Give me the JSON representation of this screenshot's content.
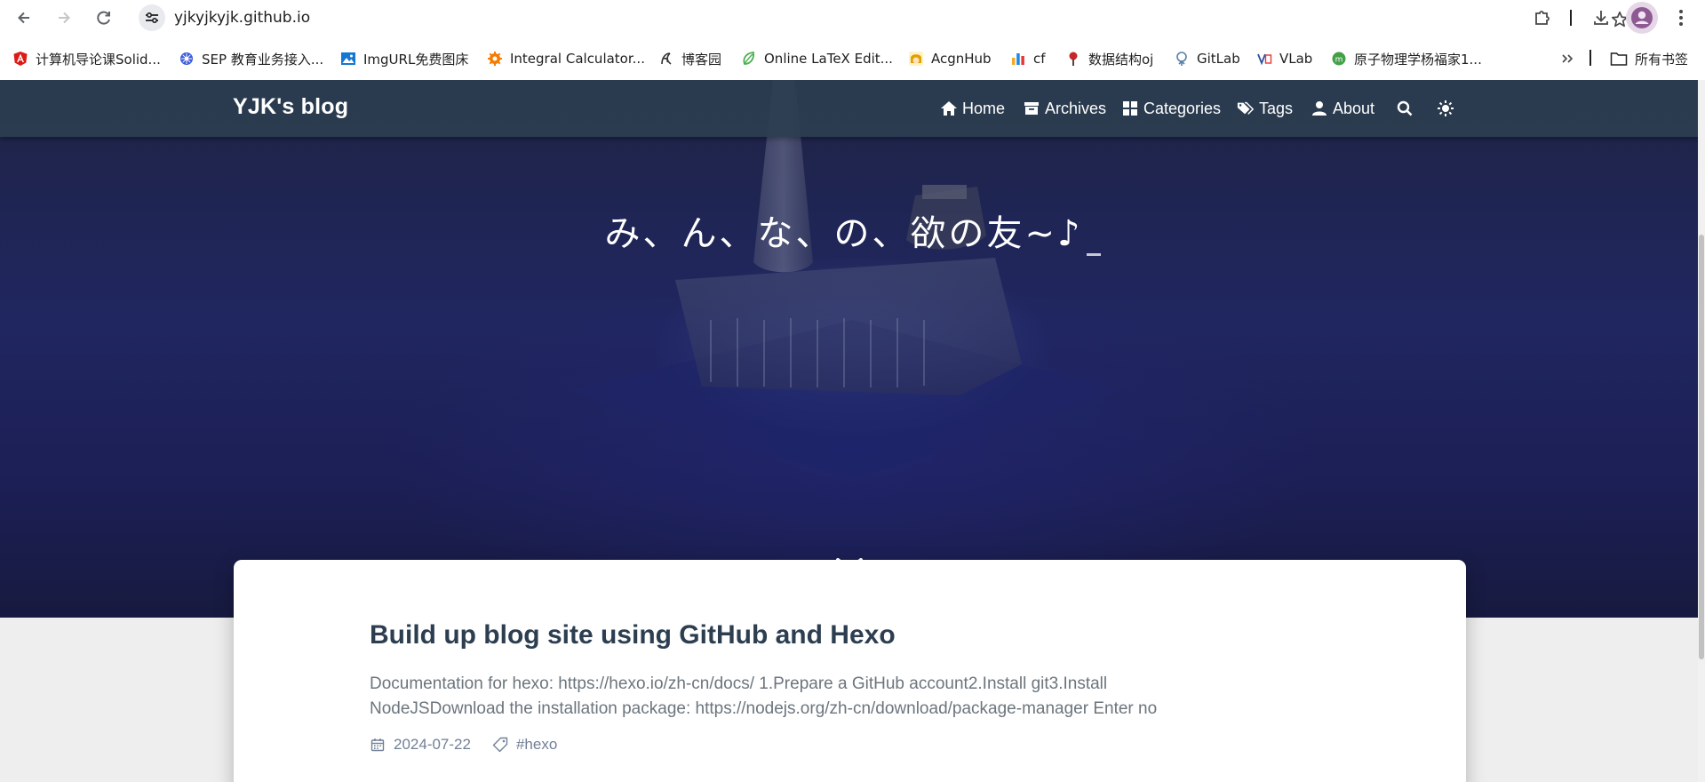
{
  "browser": {
    "url": "yjkyjkyjk.github.io",
    "icons": {
      "back": "arrow-left-icon",
      "forward": "arrow-right-icon",
      "reload": "reload-icon",
      "site_info": "tune-icon",
      "star": "star-icon",
      "extensions": "puzzle-icon",
      "downloads": "download-icon",
      "profile": "avatar-icon",
      "menu": "kebab-icon"
    },
    "bookmarks": [
      {
        "label": "计算机导论课Solid...",
        "icon": "angular-icon",
        "color": "#dd1b16"
      },
      {
        "label": "SEP 教育业务接入...",
        "icon": "helm-icon",
        "color": "#3b5bdb"
      },
      {
        "label": "ImgURL免费图床",
        "icon": "image-icon",
        "color": "#1677d2"
      },
      {
        "label": "Integral Calculator...",
        "icon": "gear-icon",
        "color": "#f57c00"
      },
      {
        "label": "博客园",
        "icon": "blog-icon",
        "color": "#333333"
      },
      {
        "label": "Online LaTeX Edit...",
        "icon": "leaf-icon",
        "color": "#4caf50"
      },
      {
        "label": "AcgnHub",
        "icon": "anime-icon",
        "color": "#e0a000"
      },
      {
        "label": "cf",
        "icon": "bar-chart-icon",
        "color": "#1e88e5"
      },
      {
        "label": "数据结构oj",
        "icon": "tree-icon",
        "color": "#c62828"
      },
      {
        "label": "GitLab",
        "icon": "gitlab-icon",
        "color": "#5a7fa8"
      },
      {
        "label": "VLab",
        "icon": "vlab-icon",
        "color": "#2b4fa0"
      },
      {
        "label": "原子物理学杨福家1...",
        "icon": "circle-icon",
        "color": "#43a047"
      }
    ],
    "all_bookmarks_label": "所有书签"
  },
  "site": {
    "brand": "YJK's blog",
    "nav": [
      {
        "label": "Home",
        "icon": "home-icon"
      },
      {
        "label": "Archives",
        "icon": "archive-icon"
      },
      {
        "label": "Categories",
        "icon": "categories-icon"
      },
      {
        "label": "Tags",
        "icon": "tags-icon"
      },
      {
        "label": "About",
        "icon": "user-icon"
      }
    ],
    "search_icon": "search-icon",
    "theme_icon": "sun-icon",
    "hero_title": "み、ん、な、の、欲の友~♪",
    "accent": "#2c3e50"
  },
  "post": {
    "title": "Build up blog site using GitHub and Hexo",
    "excerpt_line1": "Documentation for hexo: https://hexo.io/zh-cn/docs/ 1.Prepare a GitHub account2.Install git3.Install",
    "excerpt_line2": "NodeJSDownload the installation package: https://nodejs.org/zh-cn/download/package-manager Enter no",
    "date": "2024-07-22",
    "tag": "#hexo"
  }
}
